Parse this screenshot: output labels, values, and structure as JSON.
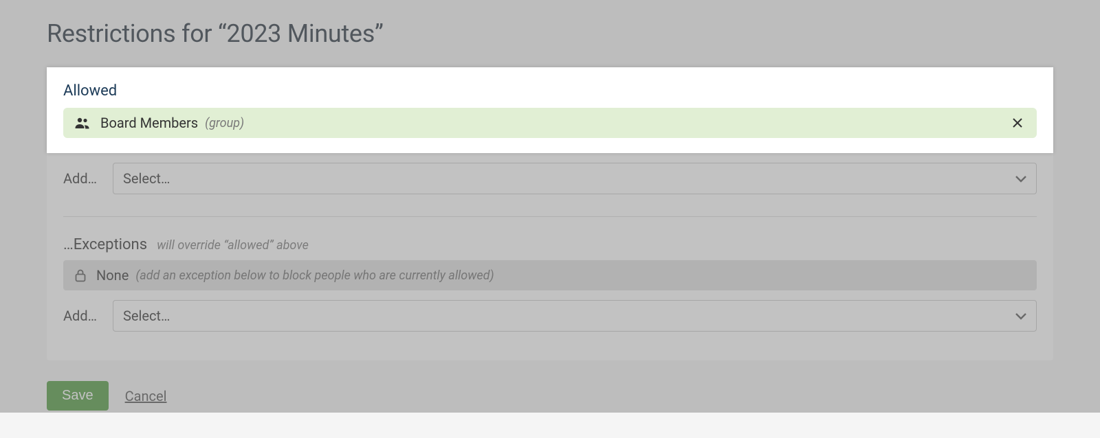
{
  "title": "Restrictions for “2023 Minutes”",
  "allowed": {
    "label": "Allowed",
    "items": [
      {
        "name": "Board Members",
        "meta": "(group)"
      }
    ],
    "add_label": "Add…",
    "select_placeholder": "Select…"
  },
  "exceptions": {
    "title": "…Exceptions",
    "subtitle": "will override “allowed” above",
    "none_label": "None",
    "none_hint": "(add an exception below to block people who are currently allowed)",
    "add_label": "Add…",
    "select_placeholder": "Select…"
  },
  "actions": {
    "save": "Save",
    "cancel": "Cancel"
  }
}
